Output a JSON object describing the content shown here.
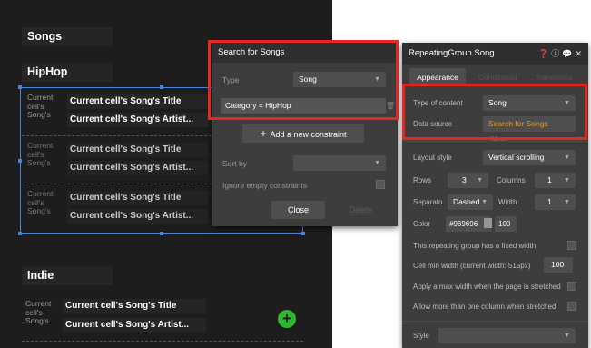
{
  "canvas": {
    "songs_header": "Songs",
    "hiphop_header": "HipHop",
    "indie_header": "Indie",
    "cell_label": "Current cell's Song's",
    "title_text": "Current cell's Song's Title",
    "artist_text": "Current cell's Song's Artist..."
  },
  "search": {
    "title": "Search for Songs",
    "type_label": "Type",
    "type_value": "Song",
    "constraint": "Category = HipHop",
    "add_constraint": "Add a new constraint",
    "sort_label": "Sort by",
    "ignore_label": "Ignore empty constraints",
    "close": "Close",
    "delete": "Delete"
  },
  "props": {
    "title": "RepeatingGroup Song",
    "tabs": [
      "Appearance",
      "Conditional",
      "Transitions"
    ],
    "type_of_content_label": "Type of content",
    "type_of_content_value": "Song",
    "data_source_label": "Data source",
    "data_source_value": "Search for Songs",
    "data_source_more": "More...",
    "layout_style_label": "Layout style",
    "layout_style_value": "Vertical scrolling",
    "rows_label": "Rows",
    "rows_value": "3",
    "columns_label": "Columns",
    "columns_value": "1",
    "separator_label": "Separato",
    "separator_value": "Dashed",
    "width_label": "Width",
    "width_value": "1",
    "color_label": "Color",
    "color_value": "#969696",
    "opacity_value": "100",
    "fixed_width_label": "This repeating group has a fixed width",
    "min_width_label": "Cell min width (current width: 515px)",
    "min_width_value": "100",
    "max_width_label": "Apply a max width when the page is stretched",
    "more_columns_label": "Allow more than one column when stretched",
    "style_label": "Style"
  },
  "colors": {
    "highlight_red": "#e8281e",
    "data_source_orange": "#e89b2a",
    "add_button_green": "#2fb52f",
    "selection_blue": "#4a86d8"
  }
}
